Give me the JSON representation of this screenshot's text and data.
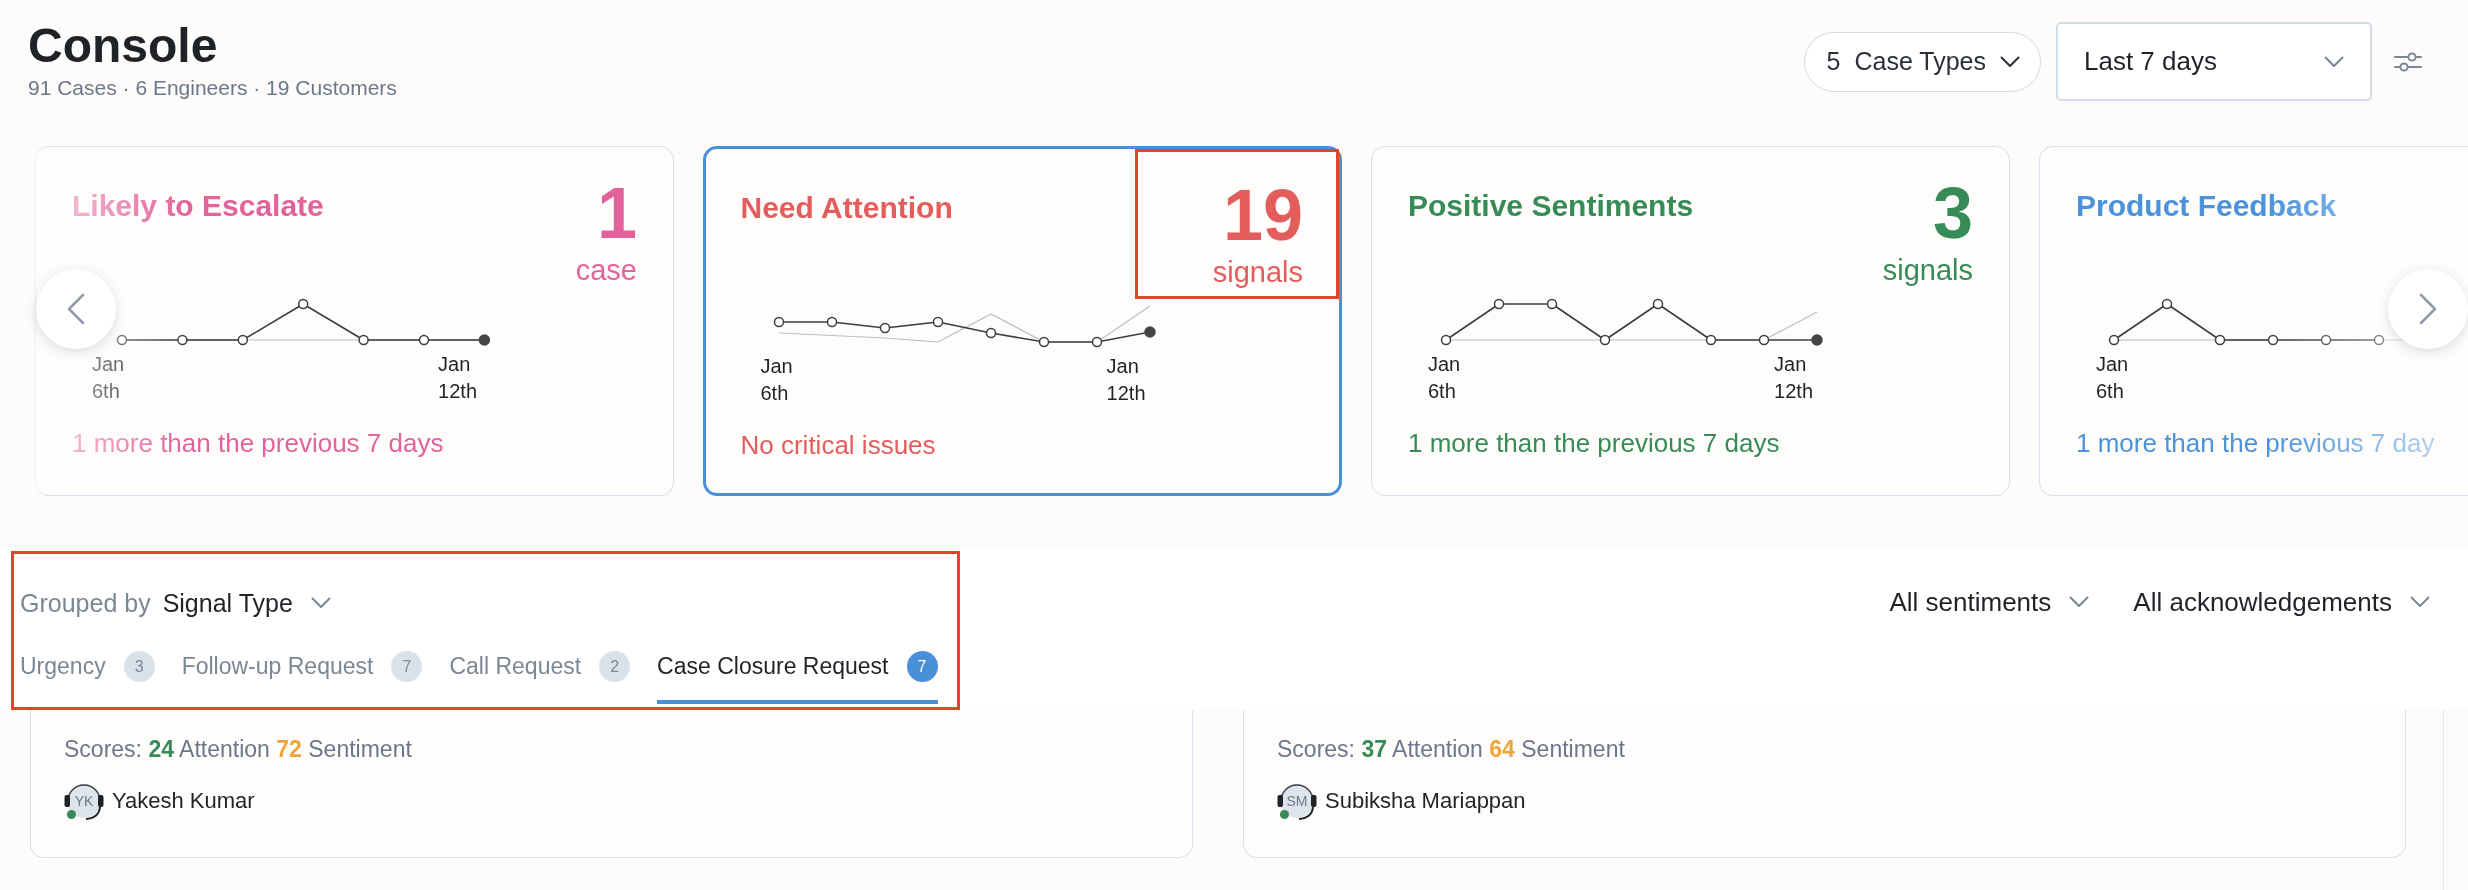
{
  "header": {
    "title": "Console",
    "subtitle": "91 Cases · 6 Engineers · 19 Customers"
  },
  "toolbar": {
    "case_types": {
      "count": "5",
      "label": "Case Types"
    },
    "period": {
      "value": "Last 7 days"
    }
  },
  "metric_cards": [
    {
      "title": "Likely to Escalate",
      "count": "1",
      "unit": "case",
      "dates": [
        "Jan 6th",
        "Jan 12th"
      ],
      "footer": "1 more than the previous 7 days",
      "color": "#e2639c",
      "selected": false
    },
    {
      "title": "Need Attention",
      "count": "19",
      "unit": "signals",
      "dates": [
        "Jan 6th",
        "Jan 12th"
      ],
      "footer": "No critical issues",
      "color": "#e35d5d",
      "selected": true,
      "highlighted": true
    },
    {
      "title": "Positive Sentiments",
      "count": "3",
      "unit": "signals",
      "dates": [
        "Jan 6th",
        "Jan 12th"
      ],
      "footer": "1 more than the previous 7 days",
      "color": "#378b56",
      "selected": false
    },
    {
      "title": "Product Feedback",
      "dates": [
        "Jan 6th"
      ],
      "footer": "1 more than the previous 7 day",
      "color": "#4a93dc",
      "selected": false
    }
  ],
  "grouping": {
    "label": "Grouped by",
    "value": "Signal Type",
    "highlighted": true,
    "tabs": [
      {
        "label": "Urgency",
        "count": "3",
        "selected": false
      },
      {
        "label": "Follow-up Request",
        "count": "7",
        "selected": false
      },
      {
        "label": "Call Request",
        "count": "2",
        "selected": false
      },
      {
        "label": "Case Closure Request",
        "count": "7",
        "selected": true
      }
    ]
  },
  "filters": [
    "All sentiments",
    "All acknowledgements"
  ],
  "cases": [
    {
      "scores_label": "Scores:",
      "attention": "24",
      "attention_label": "Attention",
      "sentiment": "72",
      "sentiment_label": "Sentiment",
      "engineer": {
        "initials": "YK",
        "name": "Yakesh Kumar",
        "online": true
      }
    },
    {
      "scores_label": "Scores:",
      "attention": "37",
      "attention_label": "Attention",
      "sentiment": "64",
      "sentiment_label": "Sentiment",
      "engineer": {
        "initials": "SM",
        "name": "Subiksha Mariappan",
        "online": true
      }
    }
  ]
}
